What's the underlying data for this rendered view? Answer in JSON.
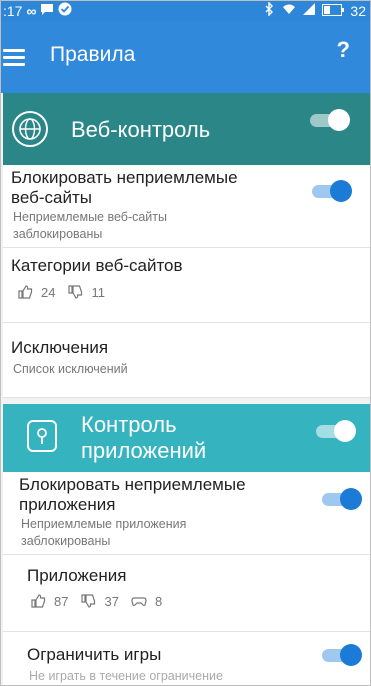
{
  "statusbar": {
    "time": ":17",
    "battery": "32"
  },
  "appbar": {
    "title": "Правила",
    "help": "?"
  },
  "web_control": {
    "title": "Веб-контроль",
    "block_row": {
      "title_line1": "Блокировать неприемлемые",
      "title_line2": "веб-сайты",
      "sub_line1": "Неприемлемые веб-сайты",
      "sub_line2": "заблокированы"
    },
    "categories_row": {
      "title": "Категории веб-сайтов",
      "likes": "24",
      "dislikes": "11"
    },
    "exceptions_row": {
      "title": "Исключения",
      "sub": "Список исключений"
    }
  },
  "app_control": {
    "title_line1": "Контроль",
    "title_line2": "приложений",
    "block_row": {
      "title_line1": "Блокировать неприемлемые",
      "title_line2": "приложения",
      "sub_line1": "Неприемлемые приложения",
      "sub_line2": "заблокированы"
    },
    "apps_row": {
      "title": "Приложения",
      "likes": "87",
      "dislikes": "37",
      "games": "8"
    },
    "games_row": {
      "title": "Ограничить игры",
      "sub": "Не играть в течение ограничение"
    }
  },
  "colors": {
    "statusbar": "#2d86d8",
    "appbar": "#3189db",
    "web_header": "#2a8687",
    "app_header": "#35b4c0",
    "toggle_on": "#1b7bd6"
  }
}
